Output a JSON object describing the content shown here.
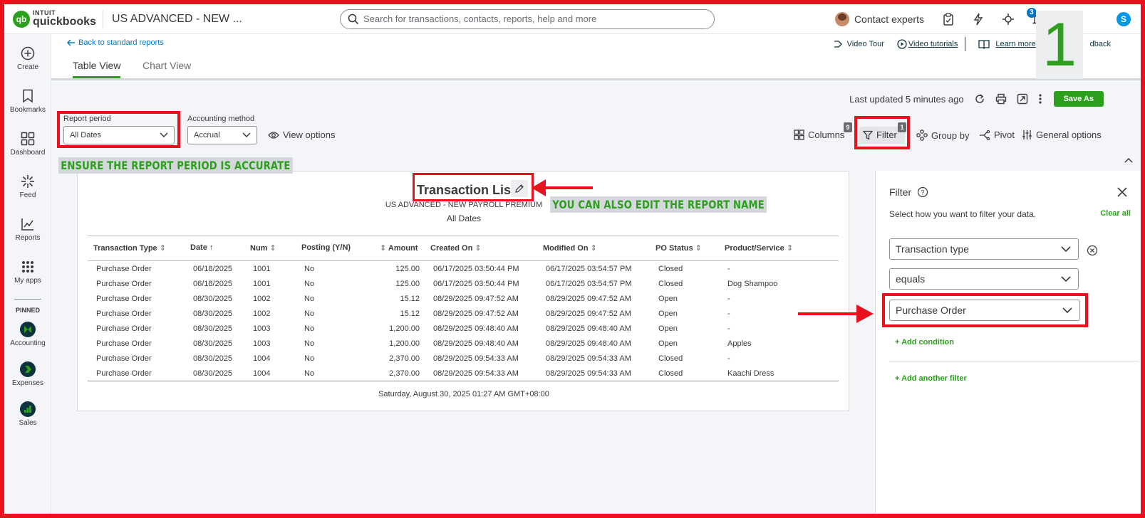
{
  "topbar": {
    "logo_small": "INTUIT",
    "logo_main": "quickbooks",
    "logo_mark": "qb",
    "company": "US ADVANCED - NEW ...",
    "search_placeholder": "Search for transactions, contacts, reports, help and more",
    "contact_experts": "Contact experts",
    "notifications_count": "3",
    "user_initial": "S"
  },
  "leftnav": {
    "items": [
      {
        "label": "Create",
        "icon": "plus-circle-icon"
      },
      {
        "label": "Bookmarks",
        "icon": "bookmark-icon"
      },
      {
        "label": "Dashboard",
        "icon": "dashboard-icon"
      },
      {
        "label": "Feed",
        "icon": "feed-icon"
      },
      {
        "label": "Reports",
        "icon": "reports-icon"
      },
      {
        "label": "My apps",
        "icon": "apps-grid-icon"
      }
    ],
    "pinned_label": "PINNED",
    "pinned": [
      {
        "label": "Accounting"
      },
      {
        "label": "Expenses"
      },
      {
        "label": "Sales"
      }
    ]
  },
  "header": {
    "back_link": "Back to standard reports",
    "tabs": [
      "Table View",
      "Chart View"
    ],
    "video_tour": "Video Tour",
    "video_tutorials": "Video tutorials",
    "learn_more": "Learn more",
    "feedback": "dback",
    "step_number": "1"
  },
  "controls": {
    "last_updated": "Last updated 5 minutes ago",
    "save_as": "Save As",
    "report_period_label": "Report period",
    "report_period_value": "All Dates",
    "accounting_method_label": "Accounting method",
    "accounting_method_value": "Accrual",
    "view_options": "View options",
    "columns": "Columns",
    "columns_badge": "9",
    "filter": "Filter",
    "filter_badge": "1",
    "group_by": "Group by",
    "pivot": "Pivot",
    "general_options": "General options"
  },
  "annotations": {
    "report_period_note": "ENSURE THE REPORT PERIOD IS ACCURATE",
    "report_name_note": "YOU CAN ALSO EDIT THE REPORT NAME"
  },
  "report": {
    "title": "Transaction List",
    "company": "US ADVANCED - NEW PAYROLL PREMIUM",
    "period": "All Dates",
    "columns": [
      "Transaction Type",
      "Date",
      "Num",
      "Posting (Y/N)",
      "Amount",
      "Created On",
      "Modified On",
      "PO Status",
      "Product/Service"
    ],
    "rows": [
      [
        "Purchase Order",
        "06/18/2025",
        "1001",
        "No",
        "125.00",
        "06/17/2025 03:50:44 PM",
        "06/17/2025 03:54:57 PM",
        "Closed",
        "-"
      ],
      [
        "Purchase Order",
        "06/18/2025",
        "1001",
        "No",
        "125.00",
        "06/17/2025 03:50:44 PM",
        "06/17/2025 03:54:57 PM",
        "Closed",
        "Dog Shampoo"
      ],
      [
        "Purchase Order",
        "08/30/2025",
        "1002",
        "No",
        "15.12",
        "08/29/2025 09:47:52 AM",
        "08/29/2025 09:47:52 AM",
        "Open",
        "-"
      ],
      [
        "Purchase Order",
        "08/30/2025",
        "1002",
        "No",
        "15.12",
        "08/29/2025 09:47:52 AM",
        "08/29/2025 09:47:52 AM",
        "Open",
        "-"
      ],
      [
        "Purchase Order",
        "08/30/2025",
        "1003",
        "No",
        "1,200.00",
        "08/29/2025 09:48:40 AM",
        "08/29/2025 09:48:40 AM",
        "Open",
        "-"
      ],
      [
        "Purchase Order",
        "08/30/2025",
        "1003",
        "No",
        "1,200.00",
        "08/29/2025 09:48:40 AM",
        "08/29/2025 09:48:40 AM",
        "Open",
        "Apples"
      ],
      [
        "Purchase Order",
        "08/30/2025",
        "1004",
        "No",
        "2,370.00",
        "08/29/2025 09:54:33 AM",
        "08/29/2025 09:54:33 AM",
        "Closed",
        "-"
      ],
      [
        "Purchase Order",
        "08/30/2025",
        "1004",
        "No",
        "2,370.00",
        "08/29/2025 09:54:33 AM",
        "08/29/2025 09:54:33 AM",
        "Closed",
        "Kaachi Dress"
      ]
    ],
    "footer": "Saturday, August 30, 2025 01:27 AM GMT+08:00"
  },
  "filter_panel": {
    "title": "Filter",
    "description": "Select how you want to filter your data.",
    "clear_all": "Clear all",
    "field": "Transaction type",
    "operator": "equals",
    "value": "Purchase Order",
    "add_condition": "+ Add condition",
    "add_another_filter": "+ Add another filter"
  },
  "colors": {
    "brand_green": "#2ca01c",
    "highlight_red": "#e8111d",
    "text": "#393a3d"
  }
}
